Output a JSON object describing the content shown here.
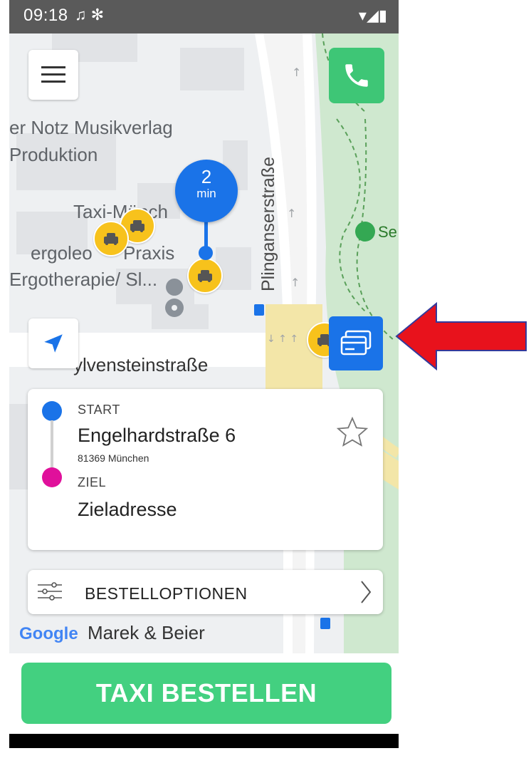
{
  "status_bar": {
    "time": "09:18",
    "left_icons": "♫ ✻",
    "right_icons": "▾◢▮"
  },
  "map": {
    "labels": {
      "poi_1": "er Notz Musikverlag",
      "poi_2": "Produktion",
      "poi_3": "Taxi-Münch",
      "poi_4": "ergoleo",
      "poi_5": "Praxis",
      "poi_6": "Ergotherapie/ Sl...",
      "street_1": "Plinganserstraße",
      "street_2": "ylvensteinstraße",
      "poi_7": "Se",
      "poi_8": "Marek & Beier"
    },
    "eta": {
      "value": "2",
      "unit": "min"
    },
    "attribution": "Google"
  },
  "route": {
    "start_label": "START",
    "start_address": "Engelhardstraße 6",
    "start_city": "81369 München",
    "dest_label": "ZIEL",
    "dest_address": "Zieladresse"
  },
  "options": {
    "label": "BESTELLOPTIONEN"
  },
  "order_button": {
    "label": "TAXI BESTELLEN"
  },
  "colors": {
    "accent_blue": "#1a73e8",
    "order_green": "#43d080",
    "call_green": "#3ec676",
    "taxi_yellow": "#f7c21c",
    "dest_magenta": "#e0109b",
    "annotation_red": "#e8121c"
  },
  "icons": {
    "menu": "menu-icon",
    "call": "phone-icon",
    "locate": "navigation-arrow-icon",
    "payment": "credit-card-icon",
    "favorite": "star-icon",
    "options": "sliders-icon",
    "chevron": "chevron-right-icon",
    "taxi": "taxi-icon"
  }
}
